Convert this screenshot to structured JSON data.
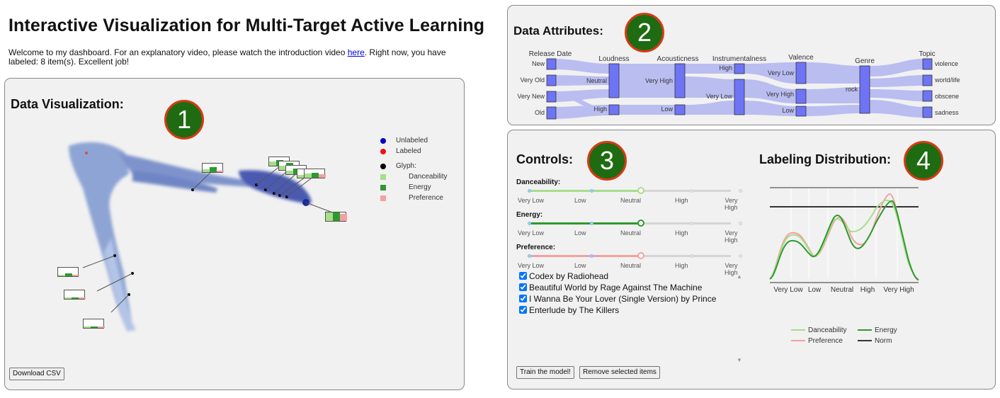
{
  "header": {
    "title": "Interactive Visualization for Multi-Target Active Learning",
    "intro_before": "Welcome to my dashboard. For an explanatory video, please watch the introduction video ",
    "intro_link": "here",
    "intro_after": ". Right now, you have labeled: 8 item(s). Excellent job!"
  },
  "panel1": {
    "title": "Data Visualization:",
    "badge": "1",
    "download_label": "Download CSV",
    "legend": [
      {
        "label": "Unlabeled",
        "color": "#0000cc",
        "shape": "circle"
      },
      {
        "label": "Labeled",
        "color": "#ee1111",
        "shape": "circle"
      },
      {
        "label": "Glyph:",
        "color": "#000000",
        "shape": "circle"
      },
      {
        "label": "Danceability",
        "color": "#a8dd8c",
        "shape": "square"
      },
      {
        "label": "Energy",
        "color": "#2e9a2e",
        "shape": "square"
      },
      {
        "label": "Preference",
        "color": "#f4a0a0",
        "shape": "square"
      }
    ]
  },
  "panel2": {
    "title": "Data Attributes:",
    "badge": "2",
    "axes": [
      {
        "name": "Release Date",
        "values": [
          "New",
          "Very Old",
          "Very New",
          "Old"
        ]
      },
      {
        "name": "Loudness",
        "values": [
          "Neutral",
          "High"
        ]
      },
      {
        "name": "Acousticness",
        "values": [
          "Very High",
          "Low"
        ]
      },
      {
        "name": "Instrumentalness",
        "values": [
          "High",
          "Very Low"
        ]
      },
      {
        "name": "Valence",
        "values": [
          "Very Low",
          "Very High",
          "Low"
        ]
      },
      {
        "name": "Genre",
        "values": [
          "rock"
        ]
      },
      {
        "name": "Topic",
        "values": [
          "violence",
          "world/life",
          "obscene",
          "sadness"
        ]
      }
    ]
  },
  "panel3": {
    "title": "Controls:",
    "badge": "3",
    "tick_labels": [
      "Very Low",
      "Low",
      "Neutral",
      "High",
      "Very\nHigh"
    ],
    "sliders": [
      {
        "label": "Danceability:",
        "value": "Neutral",
        "color": "#a8dd8c"
      },
      {
        "label": "Energy:",
        "value": "Neutral",
        "color": "#2e9a2e"
      },
      {
        "label": "Preference:",
        "value": "Neutral",
        "color": "#f4a0a0"
      }
    ],
    "items": [
      "Codex by Radiohead",
      "Beautiful World by Rage Against The Machine",
      "I Wanna Be Your Lover (Single Version) by Prince",
      "Enterlude by The Killers"
    ],
    "train_label": "Train the model!",
    "remove_label": "Remove selected items"
  },
  "panel4": {
    "title": "Labeling Distribution:",
    "badge": "4",
    "x_ticks": [
      "Very Low",
      "Low",
      "Neutral",
      "High",
      "Very High"
    ],
    "legend": [
      {
        "label": "Danceability",
        "color": "#a8dd8c"
      },
      {
        "label": "Energy",
        "color": "#2e9a2e"
      },
      {
        "label": "Preference",
        "color": "#f4a0a0"
      },
      {
        "label": "Norm",
        "color": "#333333"
      }
    ]
  }
}
